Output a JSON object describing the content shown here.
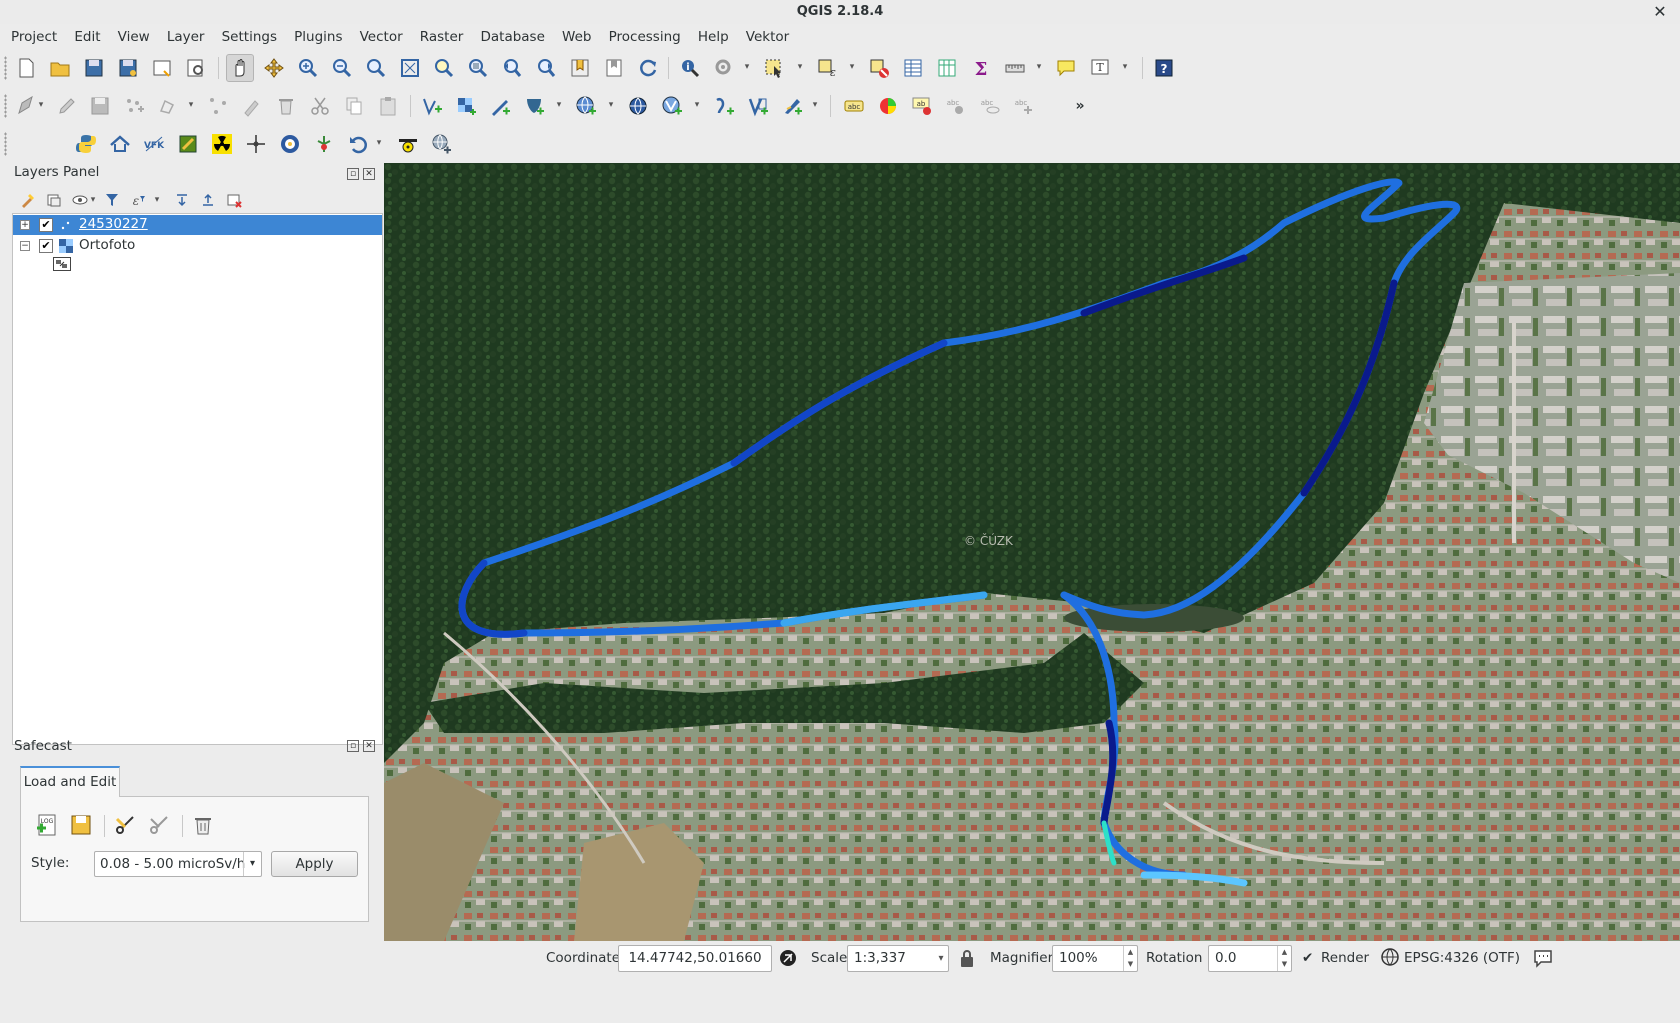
{
  "window": {
    "title": "QGIS 2.18.4",
    "close_label": "✕"
  },
  "menu": [
    "Project",
    "Edit",
    "View",
    "Layer",
    "Settings",
    "Plugins",
    "Vector",
    "Raster",
    "Database",
    "Web",
    "Processing",
    "Help",
    "Vektor"
  ],
  "toolbars": {
    "overflow_label": "»"
  },
  "layers_panel": {
    "title": "Layers Panel",
    "layers": [
      {
        "name": "24530227",
        "checked": true,
        "expanded": false,
        "selected": true,
        "icon": "point-layer-icon"
      },
      {
        "name": "Ortofoto",
        "checked": true,
        "expanded": true,
        "selected": false,
        "icon": "raster-layer-icon"
      }
    ]
  },
  "safecast_panel": {
    "title": "Safecast",
    "tab_label": "Load and Edit",
    "style_label": "Style:",
    "style_value": "0.08 - 5.00 microSv/h",
    "apply_label": "Apply"
  },
  "map": {
    "watermark": "© ČÚZK",
    "track_colors": [
      "#0a1a8c",
      "#1246c8",
      "#1f6fe0",
      "#3aa6f0",
      "#5cc6ff",
      "#2de0c8"
    ]
  },
  "statusbar": {
    "coordinate_label": "Coordinate",
    "coordinate_value": "14.47742,50.01660",
    "scale_label": "Scale",
    "scale_value": "1:3,337",
    "magnifier_label": "Magnifier",
    "magnifier_value": "100%",
    "rotation_label": "Rotation",
    "rotation_value": "0.0",
    "render_label": "Render",
    "render_checked": true,
    "crs_label": "EPSG:4326 (OTF)"
  }
}
